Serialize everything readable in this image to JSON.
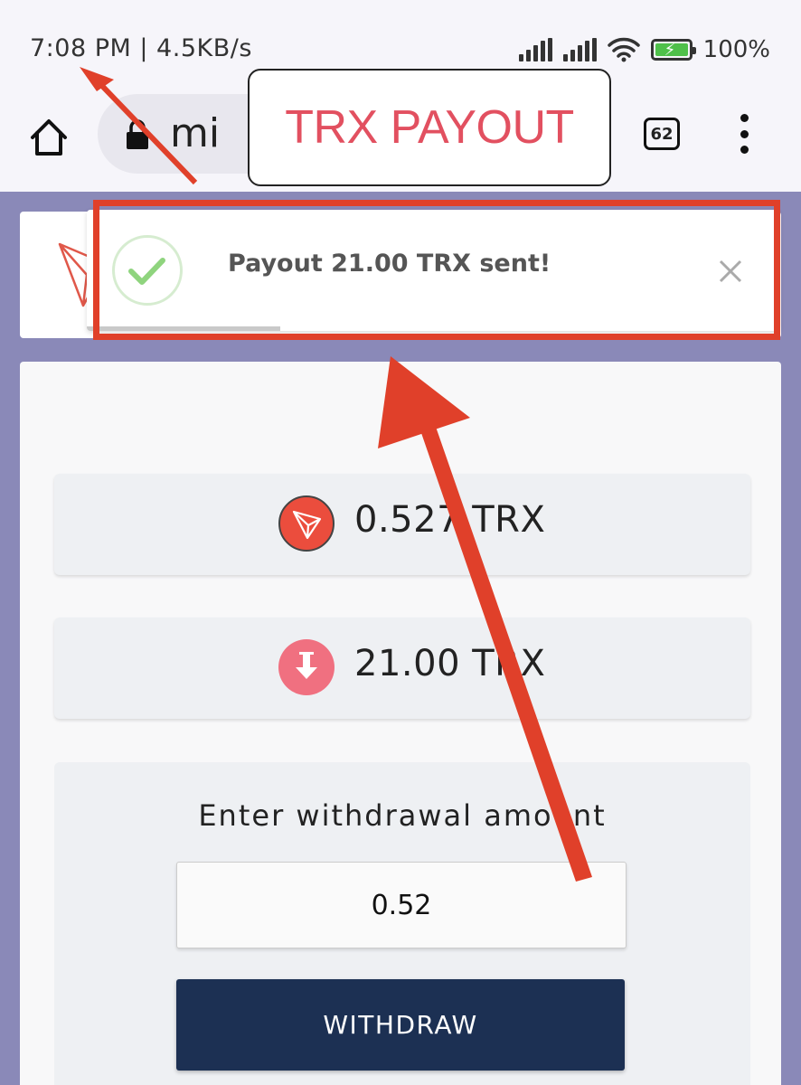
{
  "status_bar": {
    "time_speed": "7:08 PM | 4.5KB/s",
    "battery_percent": "100%"
  },
  "browser": {
    "url_fragment": "mi",
    "tab_count": "62",
    "icons": [
      "home-icon",
      "lock-icon",
      "tab-switcher-icon",
      "more-vert-icon"
    ]
  },
  "annotation": {
    "callout_text": "TRX PAYOUT",
    "color": "#e0402a"
  },
  "toast": {
    "message": "Payout 21.00 TRX sent!",
    "progress": 0.28
  },
  "stats": {
    "balance": "0.527 TRX",
    "payout": "21.00 TRX"
  },
  "withdraw": {
    "label": "Enter withdrawal amount",
    "amount": "0.52",
    "button": "WITHDRAW"
  },
  "colors": {
    "page_bg": "#8a89b8",
    "tron_red": "#eb4d3d",
    "payout_pink": "#f07080",
    "button_navy": "#1c3053",
    "success_green": "#8fd47e"
  }
}
